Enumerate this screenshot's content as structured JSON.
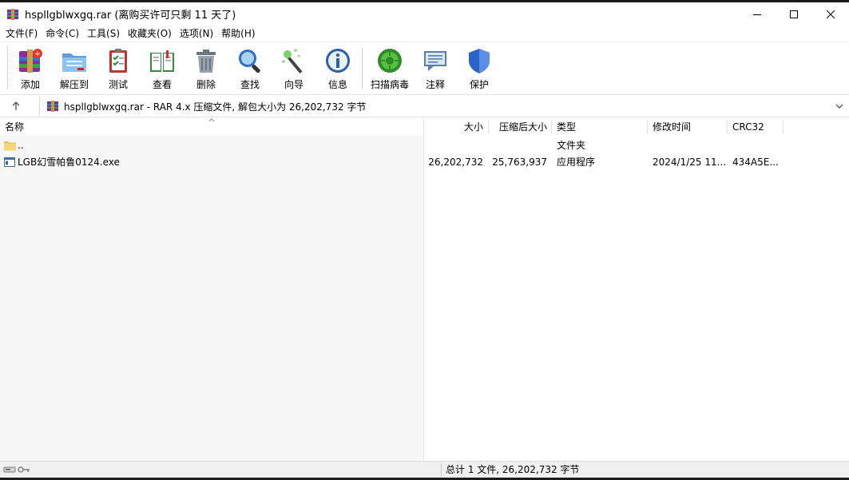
{
  "window": {
    "title": "hspllgblwxgq.rar (离购买许可只剩 11 天了)",
    "app_icon": "winrar-icon",
    "controls": [
      "minimize-icon",
      "maximize-icon",
      "close-icon"
    ]
  },
  "menu": [
    {
      "label": "文件(F)"
    },
    {
      "label": "命令(C)"
    },
    {
      "label": "工具(S)"
    },
    {
      "label": "收藏夹(O)"
    },
    {
      "label": "选项(N)"
    },
    {
      "label": "帮助(H)"
    }
  ],
  "toolbar": [
    {
      "label": "添加",
      "icon": "add-archive-icon"
    },
    {
      "label": "解压到",
      "icon": "extract-folder-icon"
    },
    {
      "label": "测试",
      "icon": "test-checklist-icon"
    },
    {
      "label": "查看",
      "icon": "view-book-icon"
    },
    {
      "label": "删除",
      "icon": "trash-icon"
    },
    {
      "label": "查找",
      "icon": "magnifier-icon"
    },
    {
      "label": "向导",
      "icon": "wizard-wand-icon"
    },
    {
      "label": "信息",
      "icon": "info-icon"
    },
    {
      "label": "扫描病毒",
      "icon": "virus-scan-icon"
    },
    {
      "label": "注释",
      "icon": "comment-icon"
    },
    {
      "label": "保护",
      "icon": "shield-icon"
    }
  ],
  "address": {
    "text": "hspllgblwxgq.rar - RAR 4.x 压缩文件, 解包大小为 26,202,732 字节"
  },
  "columns": {
    "name": "名称",
    "size": "大小",
    "packed": "压缩后大小",
    "type": "类型",
    "modified": "修改时间",
    "crc": "CRC32"
  },
  "rows": [
    {
      "name": "..",
      "size": "",
      "packed": "",
      "type": "文件夹",
      "modified": "",
      "crc": "",
      "icon": "folder-icon"
    },
    {
      "name": "LGB幻雪帕鲁0124.exe",
      "size": "26,202,732",
      "packed": "25,763,937",
      "type": "应用程序",
      "modified": "2024/1/25 11...",
      "crc": "434A5E...",
      "icon": "exe-file-icon"
    }
  ],
  "status": {
    "text": "总计 1 文件, 26,202,732 字节"
  }
}
